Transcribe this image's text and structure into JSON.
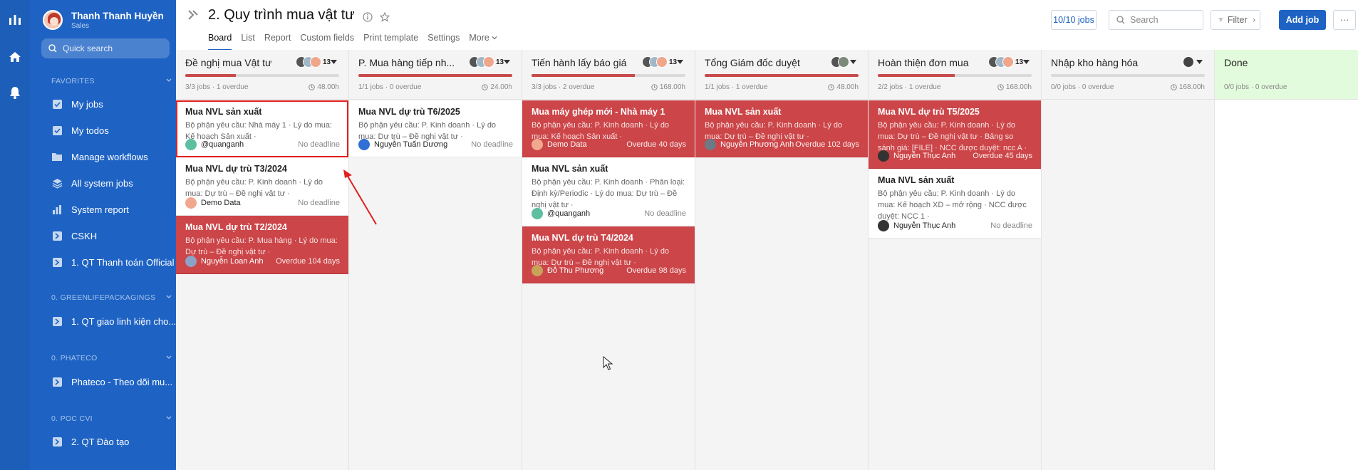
{
  "user": {
    "name": "Thanh Thanh Huyền",
    "role": "Sales"
  },
  "sidebar": {
    "search_placeholder": "Quick search",
    "favorites_label": "FAVORITES",
    "items": [
      {
        "label": "My jobs",
        "icon": "check-square-icon"
      },
      {
        "label": "My todos",
        "icon": "check-square-icon"
      },
      {
        "label": "Manage workflows",
        "icon": "folder-icon"
      },
      {
        "label": "All system jobs",
        "icon": "layers-icon"
      },
      {
        "label": "System report",
        "icon": "bar-chart-icon"
      },
      {
        "label": "CSKH",
        "icon": "workflow-icon"
      },
      {
        "label": "1. QT Thanh toán Official",
        "icon": "workflow-icon"
      }
    ],
    "groups": [
      {
        "label": "0. GREENLIFEPACKAGINGS",
        "items": [
          {
            "label": "1. QT giao linh kiện cho..."
          }
        ]
      },
      {
        "label": "0. PHATECO",
        "items": [
          {
            "label": "Phateco - Theo dõi mu..."
          }
        ]
      },
      {
        "label": "0. POC CVI",
        "items": [
          {
            "label": "2. QT Đào tạo"
          }
        ]
      }
    ]
  },
  "header": {
    "title": "2. Quy trình mua vật tư",
    "tabs": [
      "Board",
      "List",
      "Report",
      "Custom fields",
      "Print template",
      "Settings",
      "More"
    ],
    "jobs_count": "10/10 jobs",
    "search_placeholder": "Search",
    "filter_label": "Filter",
    "add_label": "Add job",
    "more_label": "···"
  },
  "columns": [
    {
      "title": "Đề nghị mua Vật tư",
      "avatar_count": "13",
      "stats": "3/3 jobs · 1 overdue",
      "hours": "48.00h",
      "progress": 0.33,
      "cards": [
        {
          "title": "Mua NVL sản xuất",
          "desc": "Bộ phận yêu cầu: Nhà máy 1 · Lý do mua: Kế hoạch Sản xuất ·",
          "assignee": "@quanganh",
          "deadline": "No deadline",
          "style": "white",
          "highlight": true
        },
        {
          "title": "Mua NVL dự trù T3/2024",
          "desc": "Bộ phận yêu cầu: P. Kinh doanh · Lý do mua: Dự trù – Đề nghị vật tư ·",
          "assignee": "Demo Data",
          "deadline": "No deadline",
          "style": "white"
        },
        {
          "title": "Mua NVL dự trù T2/2024",
          "desc": "Bộ phận yêu cầu: P. Mua hàng · Lý do mua: Dự trù – Đề nghị vật tư ·",
          "assignee": "Nguyễn Loan Anh",
          "deadline": "Overdue 104 days",
          "style": "red"
        }
      ]
    },
    {
      "title": "P. Mua hàng tiếp nh...",
      "avatar_count": "13",
      "stats": "1/1 jobs · 0 overdue",
      "hours": "24.00h",
      "progress": 1.0,
      "cards": [
        {
          "title": "Mua NVL dự trù T6/2025",
          "desc": "Bộ phận yêu cầu: P. Kinh doanh · Lý do mua: Dự trù – Đề nghị vật tư ·",
          "assignee": "Nguyễn Tuấn Dương",
          "deadline": "No deadline",
          "style": "white"
        }
      ]
    },
    {
      "title": "Tiến hành lấy báo giá",
      "avatar_count": "13",
      "stats": "3/3 jobs · 2 overdue",
      "hours": "168.00h",
      "progress": 0.67,
      "cards": [
        {
          "title": "Mua máy ghép mới - Nhà máy 1",
          "desc": "Bộ phận yêu cầu: P. Kinh doanh · Lý do mua: Kế hoạch Sản xuất ·",
          "assignee": "Demo Data",
          "deadline": "Overdue 40 days",
          "style": "red"
        },
        {
          "title": "Mua NVL sản xuất",
          "desc": "Bộ phận yêu cầu: P. Kinh doanh · Phân loại: Định kỳ/Periodic · Lý do mua: Dự trù – Đề nghị vật tư ·",
          "assignee": "@quanganh",
          "deadline": "No deadline",
          "style": "white"
        },
        {
          "title": "Mua NVL dự trù T4/2024",
          "desc": "Bộ phận yêu cầu: P. Kinh doanh · Lý do mua: Dự trù – Đề nghị vật tư ·",
          "assignee": "Đỗ Thu Phương",
          "deadline": "Overdue 98 days",
          "style": "red"
        }
      ]
    },
    {
      "title": "Tổng Giám đốc duyệt",
      "avatar_count": "",
      "stats": "1/1 jobs · 1 overdue",
      "hours": "48.00h",
      "progress": 1.0,
      "cards": [
        {
          "title": "Mua NVL sản xuất",
          "desc": "Bộ phận yêu cầu: P. Kinh doanh · Lý do mua: Dự trù – Đề nghị vật tư ·",
          "assignee": "Nguyễn Phương Anh",
          "deadline": "Overdue 102 days",
          "style": "red"
        }
      ]
    },
    {
      "title": "Hoàn thiện đơn mua",
      "avatar_count": "13",
      "stats": "2/2 jobs · 1 overdue",
      "hours": "168.00h",
      "progress": 0.5,
      "cards": [
        {
          "title": "Mua NVL dự trù T5/2025",
          "desc": "Bộ phận yêu cầu: P. Kinh doanh · Lý do mua: Dự trù – Đề nghị vật tư · Bảng so sánh giá: [FILE] · NCC được duyệt: ncc A ·",
          "assignee": "Nguyễn Thục Anh",
          "deadline": "Overdue 45 days",
          "style": "red"
        },
        {
          "title": "Mua NVL sản xuất",
          "desc": "Bộ phận yêu cầu: P. Kinh doanh · Lý do mua: Kế hoạch XD – mở rộng · NCC được duyệt: NCC 1 ·",
          "assignee": "Nguyễn Thục Anh",
          "deadline": "No deadline",
          "style": "white"
        }
      ]
    },
    {
      "title": "Nhập kho hàng hóa",
      "avatar_count": "",
      "stats": "0/0 jobs · 0 overdue",
      "hours": "168.00h",
      "progress": 0,
      "cards": []
    },
    {
      "title": "Done",
      "avatar_count": "",
      "stats": "0/0 jobs · 0 overdue",
      "hours": "",
      "progress": 0,
      "cards": []
    }
  ],
  "colors": {
    "sidebar": "#1e63c4",
    "overdue": "#cc4548",
    "accent": "#1e63c4",
    "done": "#e2fbdc"
  }
}
